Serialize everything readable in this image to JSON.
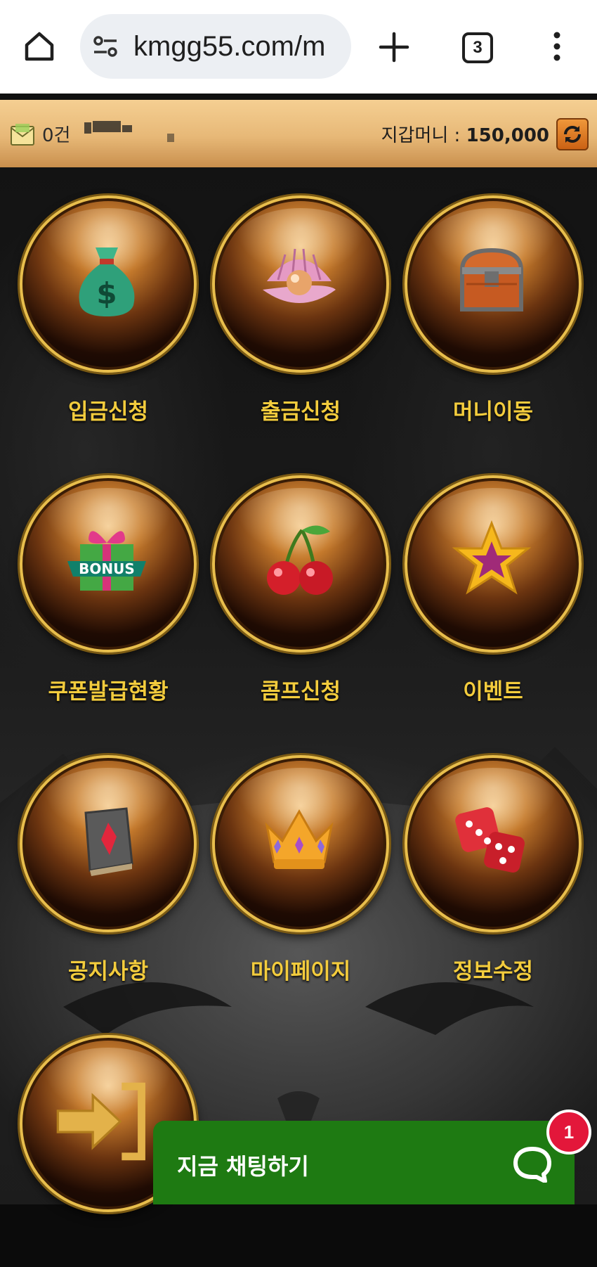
{
  "browser": {
    "url": "kmgg55.com/m",
    "tab_count": "3"
  },
  "infobar": {
    "message_count": "0건",
    "wallet_label": "지갑머니 :",
    "wallet_amount": "150,000"
  },
  "menu": [
    {
      "label": "입금신청",
      "icon": "money-bag-icon"
    },
    {
      "label": "출금신청",
      "icon": "pearl-shell-icon"
    },
    {
      "label": "머니이동",
      "icon": "treasure-chest-icon"
    },
    {
      "label": "쿠폰발급현황",
      "icon": "bonus-gift-icon"
    },
    {
      "label": "콤프신청",
      "icon": "cherry-icon"
    },
    {
      "label": "이벤트",
      "icon": "star-icon"
    },
    {
      "label": "공지사항",
      "icon": "book-icon"
    },
    {
      "label": "마이페이지",
      "icon": "crown-icon"
    },
    {
      "label": "정보수정",
      "icon": "dice-icon"
    },
    {
      "label": "",
      "icon": "logout-arrow-icon"
    }
  ],
  "chat": {
    "label": "지금 채팅하기",
    "badge": "1",
    "color": "#1e7a12"
  }
}
